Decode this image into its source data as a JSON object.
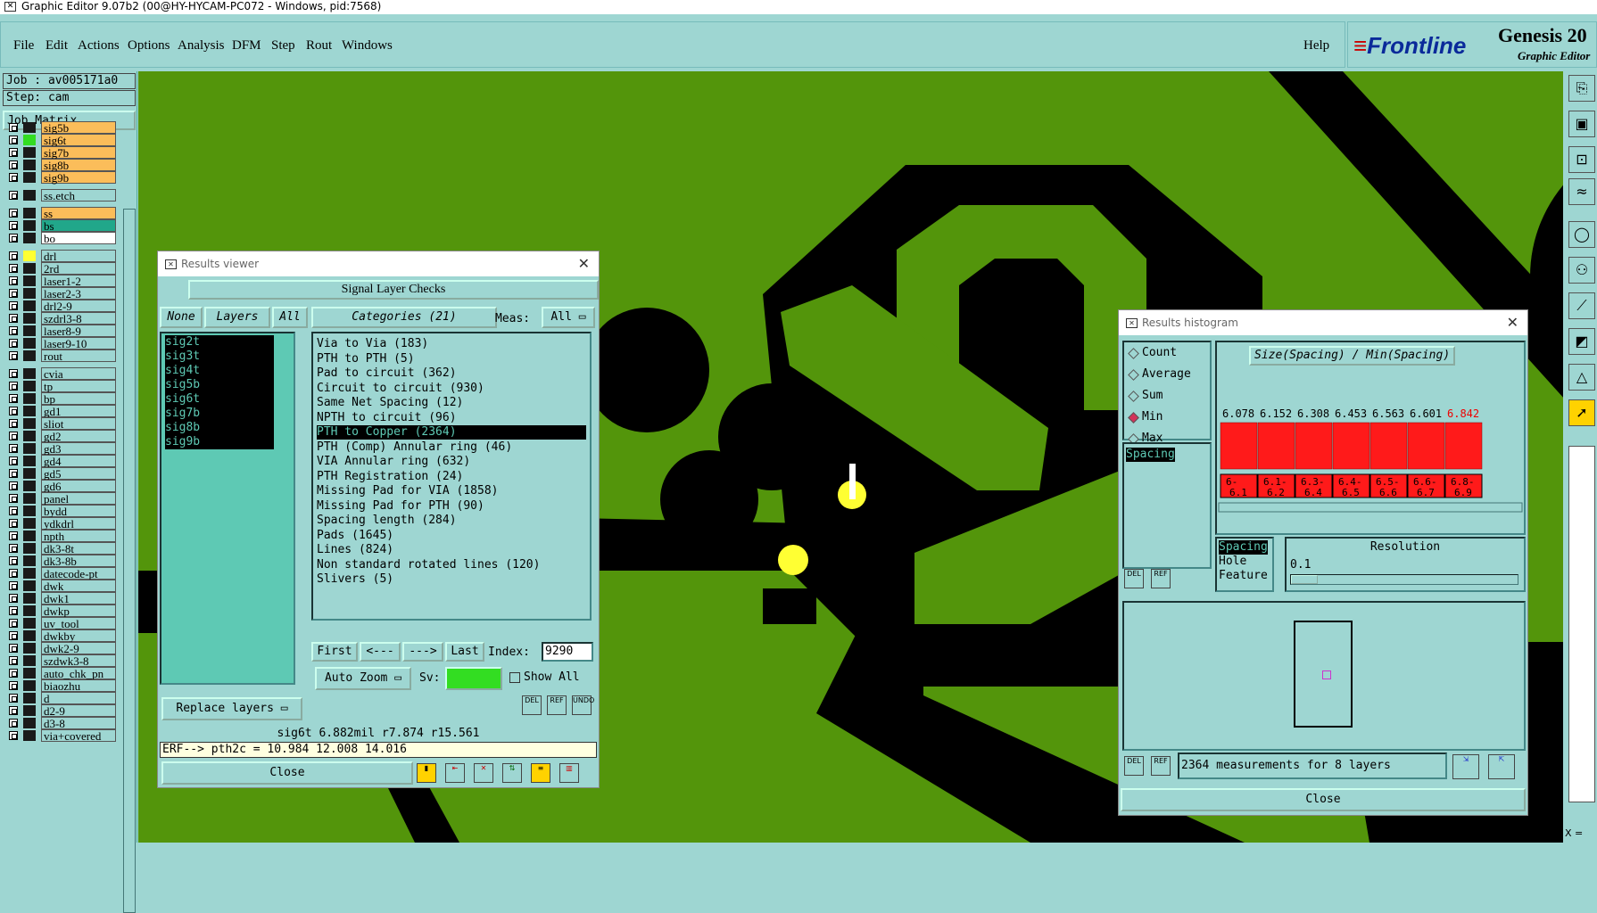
{
  "window_title": "Graphic Editor 9.07b2 (00@HY-HYCAM-PC072 - Windows, pid:7568)",
  "menu": [
    "File",
    "Edit",
    "Actions",
    "Options",
    "Analysis",
    "DFM",
    "Step",
    "Rout",
    "Windows"
  ],
  "help": "Help",
  "logo": {
    "brand": "Frontline",
    "product": "Genesis 20",
    "subtitle": "Graphic Editor"
  },
  "job": "Job : av005171a0",
  "step": "Step: cam",
  "job_matrix": "Job Matrix ...",
  "layers_group1": [
    {
      "name": "sig5b",
      "color": "#fbbd5a"
    },
    {
      "name": "sig6t",
      "color": "#fbbd5a"
    },
    {
      "name": "sig7b",
      "color": "#fbbd5a"
    },
    {
      "name": "sig8b",
      "color": "#fbbd5a"
    },
    {
      "name": "sig9b",
      "color": "#fbbd5a"
    }
  ],
  "layer_ssetch": "ss.etch",
  "layers_group2": [
    {
      "name": "ss",
      "color": "#fbbd5a"
    },
    {
      "name": "bs",
      "color": "#21a78a"
    },
    {
      "name": "bo",
      "color": "#ffffff"
    }
  ],
  "layers_group3": [
    "drl",
    "2rd",
    "laser1-2",
    "laser2-3",
    "drl2-9",
    "szdrl3-8",
    "laser8-9",
    "laser9-10",
    "rout"
  ],
  "layers_group4": [
    "cvia",
    "tp",
    "bp",
    "gd1",
    "sliot",
    "gd2",
    "gd3",
    "gd4",
    "gd5",
    "gd6",
    "panel",
    "bydd",
    "ydkdrl",
    "npth",
    "dk3-8t",
    "dk3-8b",
    "datecode-pt",
    "dwk",
    "dwk1",
    "dwkp",
    "uv_tool",
    "dwkby",
    "dwk2-9",
    "szdwk3-8",
    "auto_chk_pn",
    "biaozhu",
    "d",
    "d2-9",
    "d3-8",
    "via+covered"
  ],
  "results_viewer": {
    "title": "Results viewer",
    "header": "Signal Layer Checks",
    "none": "None",
    "layers": "Layers",
    "all": "All",
    "categories": "Categories (21)",
    "meas_label": "Meas:",
    "meas_value": "All",
    "layer_list": [
      "sig2t",
      "sig3t",
      "sig4t",
      "sig5b",
      "sig6t",
      "sig7b",
      "sig8b",
      "sig9b"
    ],
    "category_list": [
      "Via to Via (183)",
      "PTH to PTH (5)",
      "Pad to circuit (362)",
      "Circuit to circuit (930)",
      "Same Net Spacing (12)",
      "NPTH to circuit (96)",
      "PTH to Copper (2364)",
      "PTH (Comp) Annular ring (46)",
      "VIA Annular ring (632)",
      "PTH Registration (24)",
      "Missing Pad for VIA (1858)",
      "Missing Pad for PTH (90)",
      "Spacing length (284)",
      "Pads (1645)",
      "Lines (824)",
      "Non standard rotated lines (120)",
      "Slivers (5)"
    ],
    "selected_category": "PTH to Copper (2364)",
    "nav": {
      "first": "First",
      "prev": "<---",
      "next": "--->",
      "last": "Last",
      "index_label": "Index:",
      "index_value": "9290"
    },
    "auto_zoom": "Auto Zoom",
    "sv": "Sv:",
    "show_all": "Show All",
    "replace_layers": "Replace layers",
    "status1": "sig6t 6.882mil  r7.874  r15.561",
    "status2": "ERF--> pth2c = 10.984 12.008 14.016",
    "close": "Close",
    "icon_labels": [
      "DEL",
      "REF",
      "UNDO"
    ]
  },
  "results_histogram": {
    "title": "Results histogram",
    "modes": [
      "Count",
      "Average",
      "Sum",
      "Min",
      "Max"
    ],
    "selected_mode": "Min",
    "spacing_item": "Spacing",
    "chart_title": "Size(Spacing) / Min(Spacing)",
    "chart_data": {
      "type": "bar",
      "title": "Size(Spacing) / Min(Spacing)",
      "categories": [
        "6-6.1",
        "6.1-6.2",
        "6.3-6.4",
        "6.4-6.5",
        "6.5-6.6",
        "6.6-6.7",
        "6.8-6.9"
      ],
      "values": [
        6.078,
        6.152,
        6.308,
        6.453,
        6.563,
        6.601,
        6.842
      ],
      "value_labels": [
        "6.078",
        "6.152",
        "6.308",
        "6.453",
        "6.563",
        "6.601",
        "6.842"
      ],
      "category_labels": [
        [
          "6-",
          "6.1"
        ],
        [
          "6.1-",
          "6.2"
        ],
        [
          "6.3-",
          "6.4"
        ],
        [
          "6.4-",
          "6.5"
        ],
        [
          "6.5-",
          "6.6"
        ],
        [
          "6.6-",
          "6.7"
        ],
        [
          "6.8-",
          "6.9"
        ]
      ],
      "bar_color": "#ff1a1a"
    },
    "types": [
      "Spacing",
      "Hole",
      "Feature"
    ],
    "resolution_label": "Resolution",
    "resolution_value": "0.1",
    "measurements": "2364 measurements for 8 layers",
    "close": "Close",
    "icon_labels": [
      "DEL",
      "REF"
    ]
  },
  "coord_x": "X ="
}
